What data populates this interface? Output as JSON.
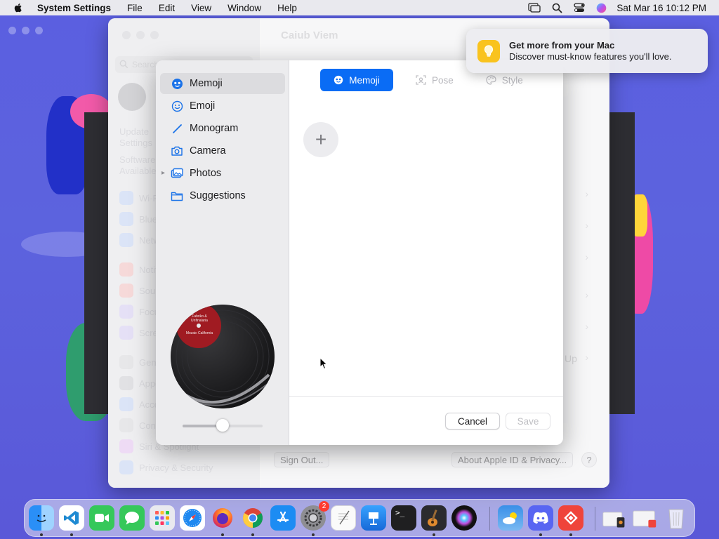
{
  "menubar": {
    "app_name": "System Settings",
    "menus": [
      "File",
      "Edit",
      "View",
      "Window",
      "Help"
    ],
    "datetime": "Sat Mar 16  10:12 PM"
  },
  "settings_window": {
    "title": "Caiub Viem",
    "search_placeholder": "Search",
    "update_text_1": "Update",
    "update_text_2": "Settings",
    "software_text_1": "Software",
    "software_text_2": "Available",
    "sidebar_items": [
      "Wi-Fi",
      "Bluetooth",
      "Network",
      "Notifications",
      "Sound",
      "Focus",
      "Screen Time",
      "General",
      "Appearance",
      "Accessibility",
      "Control Center",
      "Siri & Spotlight",
      "Privacy & Security"
    ],
    "right_fragment": "Up",
    "sign_out_label": "Sign Out...",
    "about_label": "About Apple ID & Privacy...",
    "help_label": "?"
  },
  "sheet": {
    "sidebar": [
      {
        "label": "Memoji",
        "icon": "memoji-icon"
      },
      {
        "label": "Emoji",
        "icon": "emoji-icon"
      },
      {
        "label": "Monogram",
        "icon": "monogram-icon"
      },
      {
        "label": "Camera",
        "icon": "camera-icon"
      },
      {
        "label": "Photos",
        "icon": "photos-icon"
      },
      {
        "label": "Suggestions",
        "icon": "folder-icon"
      }
    ],
    "selected": "Memoji",
    "record_label_top": "Fabriko & Unfinalaria",
    "record_label_bottom": "Mozaic California",
    "zoom_slider_value": 0.5,
    "tabs": [
      {
        "label": "Memoji",
        "active": true
      },
      {
        "label": "Pose",
        "active": false
      },
      {
        "label": "Style",
        "active": false
      }
    ],
    "add_label": "+",
    "cancel_label": "Cancel",
    "save_label": "Save"
  },
  "notification": {
    "title": "Get more from your Mac",
    "body": "Discover must-know features you'll love."
  },
  "dock": {
    "apps": [
      "Finder",
      "Visual Studio Code",
      "FaceTime",
      "Messages",
      "Launchpad",
      "Safari",
      "Firefox",
      "Chrome",
      "App Store",
      "System Settings",
      "TextEdit",
      "Keynote",
      "Terminal",
      "GarageBand",
      "Siri",
      "Weather",
      "Discord",
      "AnyDesk",
      "Downloads",
      "Documents",
      "Trash"
    ],
    "system_settings_badge": "2"
  },
  "colors": {
    "accent": "#0a6cf5",
    "wallpaper": "#5b5fe0",
    "notification_icon": "#f9c31e"
  }
}
